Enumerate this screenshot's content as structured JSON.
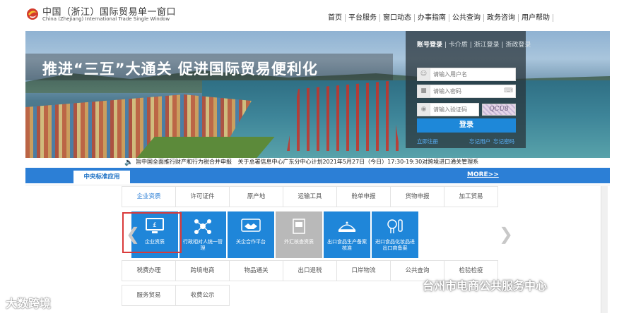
{
  "header": {
    "title": "中国（浙江）国际贸易单一窗口",
    "subtitle": "China (Zhejiang) International Trade Single Window",
    "nav": [
      "首页",
      "平台服务",
      "窗口动态",
      "办事指南",
      "公共查询",
      "政务咨询",
      "用户帮助"
    ]
  },
  "banner": {
    "slogan": "推进“三互”大通关  促进国际贸易便利化"
  },
  "login": {
    "tabs": [
      "账号登录",
      "卡介质",
      "浙江登录",
      "浙政登录"
    ],
    "username_placeholder": "请输入用户名",
    "password_placeholder": "请输入密码",
    "captcha_placeholder": "请输入验证码",
    "captcha_text": "QCU8",
    "submit": "登录",
    "register": "立即注册",
    "forgot_user": "忘记用户",
    "forgot_password": "忘记密码"
  },
  "notice": {
    "items": [
      "旨中国全面推行财产和行为税合并申报",
      "关于总署信息中心广东分中心计划2021年5月27日（今日）17:30-19:30对跨境进口通关管理系"
    ]
  },
  "center": {
    "tab": "中央标准应用",
    "more": "MORE>>",
    "categories_top": [
      "企业资质",
      "许可证件",
      "原产地",
      "运输工具",
      "舱单申报",
      "货物申报",
      "加工贸易"
    ],
    "categories_bottom": [
      "税费办理",
      "跨境电商",
      "物品通关",
      "出口退税",
      "口岸物流",
      "公共查询",
      "检验检疫"
    ],
    "categories_last": [
      "服务贸易",
      "收费公示"
    ],
    "tiles": [
      {
        "label": "企业资质",
        "icon": "monitor-icon",
        "gray": false
      },
      {
        "label": "行政相对人统一管理",
        "icon": "people-network-icon",
        "gray": false
      },
      {
        "label": "关企合作平台",
        "icon": "handshake-icon",
        "gray": false
      },
      {
        "label": "外汇核查资质",
        "icon": "document-icon",
        "gray": true
      },
      {
        "label": "出口食品生产备案核准",
        "icon": "food-icon",
        "gray": false
      },
      {
        "label": "进口食品化妆品进出口商备案",
        "icon": "cosmetics-icon",
        "gray": false
      }
    ]
  },
  "watermarks": {
    "left": "大数跨境",
    "right": "台州市电商公共服务中心"
  },
  "colors": {
    "primary_blue": "#2c7fd6",
    "tile_blue": "#1f86d9",
    "highlight_red": "#d93a3a"
  }
}
